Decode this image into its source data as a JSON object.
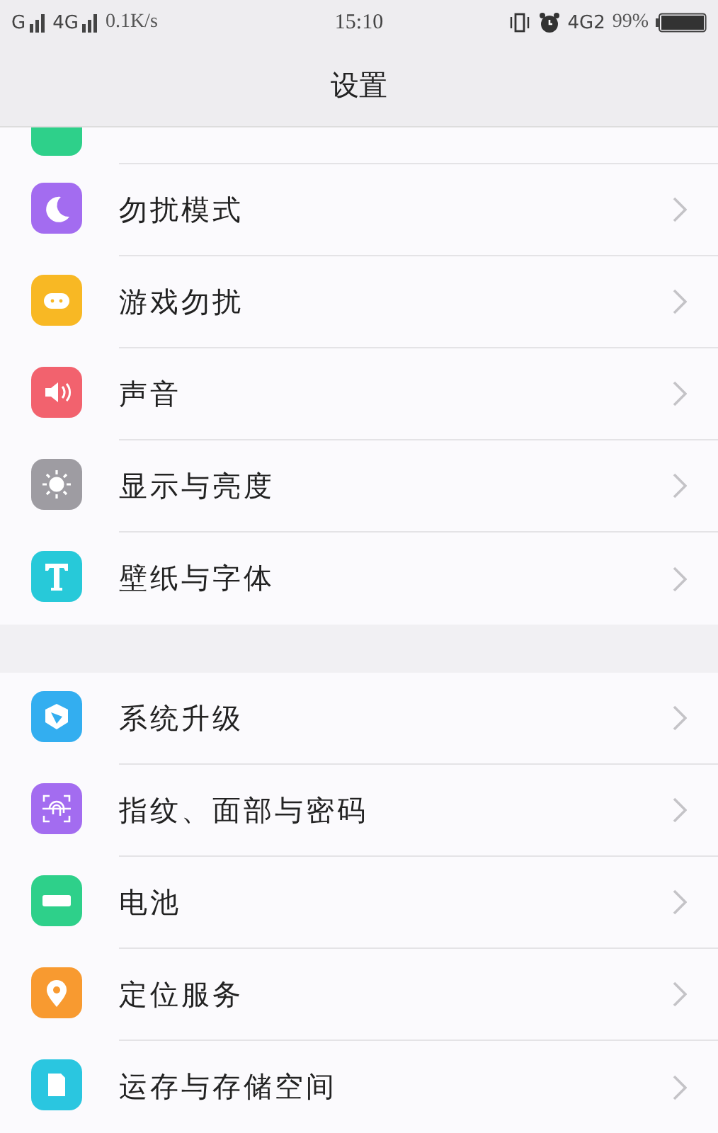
{
  "status_bar": {
    "sim1": "G",
    "sim2": "4G",
    "speed": "0.1K/s",
    "time": "15:10",
    "network": "4G2",
    "battery": "99%"
  },
  "header": {
    "title": "设置"
  },
  "groups": [
    {
      "items": [
        {
          "kind": "partial"
        },
        {
          "kind": "moon",
          "label": "勿扰模式"
        },
        {
          "kind": "game",
          "label": "游戏勿扰"
        },
        {
          "kind": "sound",
          "label": "声音"
        },
        {
          "kind": "sun",
          "label": "显示与亮度"
        },
        {
          "kind": "font",
          "label": "壁纸与字体"
        }
      ]
    },
    {
      "items": [
        {
          "kind": "upgrade",
          "label": "系统升级"
        },
        {
          "kind": "fingerprint",
          "label": "指纹、面部与密码"
        },
        {
          "kind": "battery",
          "label": "电池"
        },
        {
          "kind": "location",
          "label": "定位服务"
        },
        {
          "kind": "storage",
          "label": "运存与存储空间"
        }
      ]
    }
  ]
}
